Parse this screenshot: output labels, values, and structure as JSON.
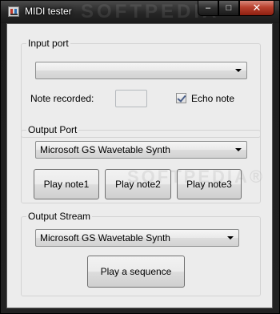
{
  "window": {
    "title": "MIDI tester"
  },
  "caption": {
    "minimize": "–",
    "maximize": "□",
    "close": "✕"
  },
  "watermark": {
    "top": "SOFTPEDIA",
    "mid": "SOFTPEDIA®"
  },
  "input_group": {
    "legend": "Input port",
    "port_value": "",
    "note_recorded_label": "Note recorded:",
    "note_recorded_value": "",
    "echo_label": "Echo note",
    "echo_checked": true
  },
  "output_group": {
    "legend": "Output Port",
    "port_value": "Microsoft GS Wavetable Synth",
    "buttons": [
      "Play note1",
      "Play note2",
      "Play note3"
    ]
  },
  "stream_group": {
    "legend": "Output Stream",
    "port_value": "Microsoft GS Wavetable Synth",
    "sequence_button": "Play a sequence"
  }
}
